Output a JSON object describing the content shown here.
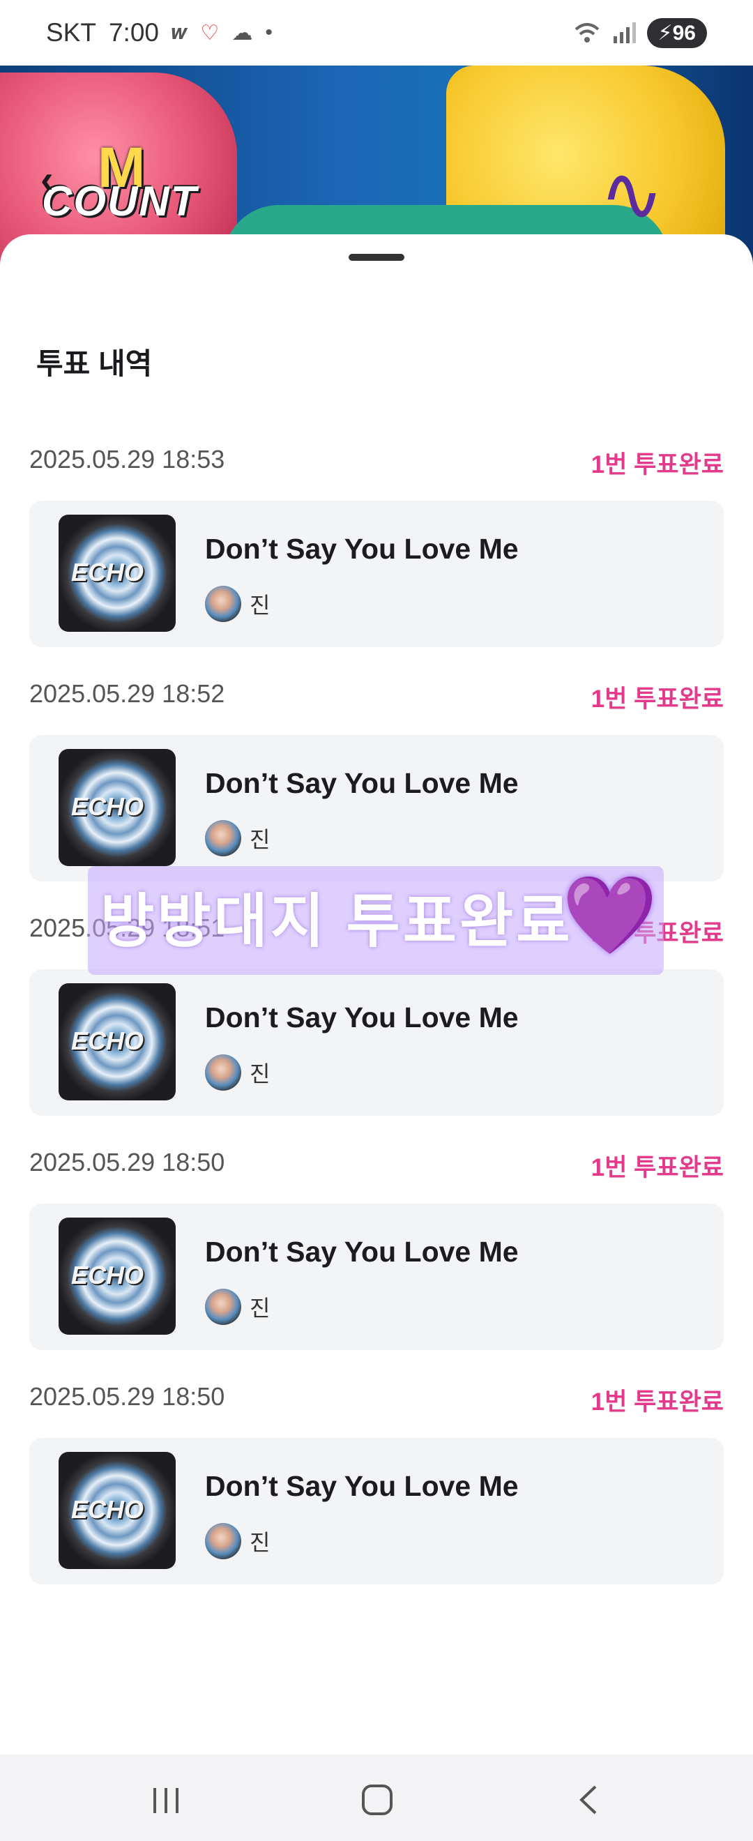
{
  "status_bar": {
    "carrier": "SKT",
    "time": "7:00",
    "battery": "96",
    "icons": [
      "w-app-icon",
      "heart-app-icon",
      "cloud-icon",
      "dot-icon",
      "wifi-icon",
      "signal-icon",
      "battery-icon"
    ]
  },
  "banner": {
    "logo_m": "M",
    "logo_text": "COUNT"
  },
  "sheet": {
    "title": "투표 내역"
  },
  "votes": [
    {
      "date": "2025.05.29 18:53",
      "status": "1번 투표완료",
      "song": "Don’t Say You Love Me",
      "artist": "진",
      "album": "ECHO"
    },
    {
      "date": "2025.05.29 18:52",
      "status": "1번 투표완료",
      "song": "Don’t Say You Love Me",
      "artist": "진",
      "album": "ECHO"
    },
    {
      "date": "2025.05.29 18:51",
      "status": "1번 투표완료",
      "song": "Don’t Say You Love Me",
      "artist": "진",
      "album": "ECHO"
    },
    {
      "date": "2025.05.29 18:50",
      "status": "1번 투표완료",
      "song": "Don’t Say You Love Me",
      "artist": "진",
      "album": "ECHO"
    },
    {
      "date": "2025.05.29 18:50",
      "status": "1번 투표완료",
      "song": "Don’t Say You Love Me",
      "artist": "진",
      "album": "ECHO"
    }
  ],
  "sticker": {
    "text": "방방대지 투표완료",
    "emoji": "💜"
  },
  "colors": {
    "accent": "#e43a8b",
    "card_bg": "#f3f4f6"
  }
}
